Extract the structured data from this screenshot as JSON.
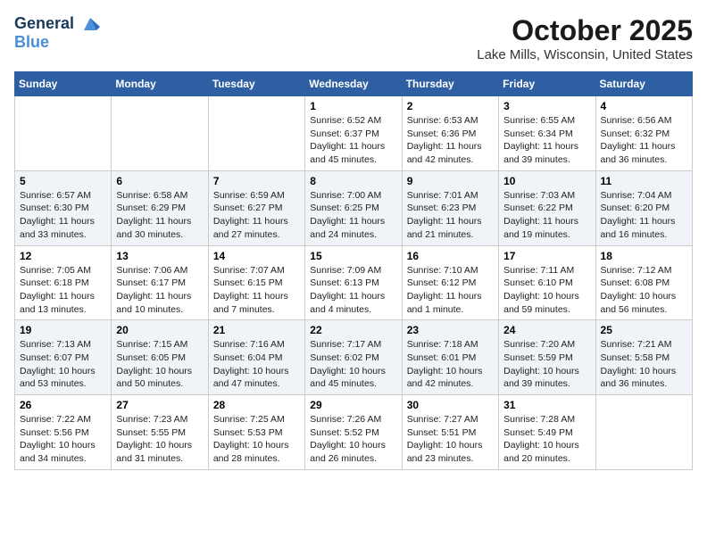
{
  "header": {
    "logo_line1": "General",
    "logo_line2": "Blue",
    "month": "October 2025",
    "location": "Lake Mills, Wisconsin, United States"
  },
  "weekdays": [
    "Sunday",
    "Monday",
    "Tuesday",
    "Wednesday",
    "Thursday",
    "Friday",
    "Saturday"
  ],
  "weeks": [
    [
      {
        "day": "",
        "sunrise": "",
        "sunset": "",
        "daylight": ""
      },
      {
        "day": "",
        "sunrise": "",
        "sunset": "",
        "daylight": ""
      },
      {
        "day": "",
        "sunrise": "",
        "sunset": "",
        "daylight": ""
      },
      {
        "day": "1",
        "sunrise": "Sunrise: 6:52 AM",
        "sunset": "Sunset: 6:37 PM",
        "daylight": "Daylight: 11 hours and 45 minutes."
      },
      {
        "day": "2",
        "sunrise": "Sunrise: 6:53 AM",
        "sunset": "Sunset: 6:36 PM",
        "daylight": "Daylight: 11 hours and 42 minutes."
      },
      {
        "day": "3",
        "sunrise": "Sunrise: 6:55 AM",
        "sunset": "Sunset: 6:34 PM",
        "daylight": "Daylight: 11 hours and 39 minutes."
      },
      {
        "day": "4",
        "sunrise": "Sunrise: 6:56 AM",
        "sunset": "Sunset: 6:32 PM",
        "daylight": "Daylight: 11 hours and 36 minutes."
      }
    ],
    [
      {
        "day": "5",
        "sunrise": "Sunrise: 6:57 AM",
        "sunset": "Sunset: 6:30 PM",
        "daylight": "Daylight: 11 hours and 33 minutes."
      },
      {
        "day": "6",
        "sunrise": "Sunrise: 6:58 AM",
        "sunset": "Sunset: 6:29 PM",
        "daylight": "Daylight: 11 hours and 30 minutes."
      },
      {
        "day": "7",
        "sunrise": "Sunrise: 6:59 AM",
        "sunset": "Sunset: 6:27 PM",
        "daylight": "Daylight: 11 hours and 27 minutes."
      },
      {
        "day": "8",
        "sunrise": "Sunrise: 7:00 AM",
        "sunset": "Sunset: 6:25 PM",
        "daylight": "Daylight: 11 hours and 24 minutes."
      },
      {
        "day": "9",
        "sunrise": "Sunrise: 7:01 AM",
        "sunset": "Sunset: 6:23 PM",
        "daylight": "Daylight: 11 hours and 21 minutes."
      },
      {
        "day": "10",
        "sunrise": "Sunrise: 7:03 AM",
        "sunset": "Sunset: 6:22 PM",
        "daylight": "Daylight: 11 hours and 19 minutes."
      },
      {
        "day": "11",
        "sunrise": "Sunrise: 7:04 AM",
        "sunset": "Sunset: 6:20 PM",
        "daylight": "Daylight: 11 hours and 16 minutes."
      }
    ],
    [
      {
        "day": "12",
        "sunrise": "Sunrise: 7:05 AM",
        "sunset": "Sunset: 6:18 PM",
        "daylight": "Daylight: 11 hours and 13 minutes."
      },
      {
        "day": "13",
        "sunrise": "Sunrise: 7:06 AM",
        "sunset": "Sunset: 6:17 PM",
        "daylight": "Daylight: 11 hours and 10 minutes."
      },
      {
        "day": "14",
        "sunrise": "Sunrise: 7:07 AM",
        "sunset": "Sunset: 6:15 PM",
        "daylight": "Daylight: 11 hours and 7 minutes."
      },
      {
        "day": "15",
        "sunrise": "Sunrise: 7:09 AM",
        "sunset": "Sunset: 6:13 PM",
        "daylight": "Daylight: 11 hours and 4 minutes."
      },
      {
        "day": "16",
        "sunrise": "Sunrise: 7:10 AM",
        "sunset": "Sunset: 6:12 PM",
        "daylight": "Daylight: 11 hours and 1 minute."
      },
      {
        "day": "17",
        "sunrise": "Sunrise: 7:11 AM",
        "sunset": "Sunset: 6:10 PM",
        "daylight": "Daylight: 10 hours and 59 minutes."
      },
      {
        "day": "18",
        "sunrise": "Sunrise: 7:12 AM",
        "sunset": "Sunset: 6:08 PM",
        "daylight": "Daylight: 10 hours and 56 minutes."
      }
    ],
    [
      {
        "day": "19",
        "sunrise": "Sunrise: 7:13 AM",
        "sunset": "Sunset: 6:07 PM",
        "daylight": "Daylight: 10 hours and 53 minutes."
      },
      {
        "day": "20",
        "sunrise": "Sunrise: 7:15 AM",
        "sunset": "Sunset: 6:05 PM",
        "daylight": "Daylight: 10 hours and 50 minutes."
      },
      {
        "day": "21",
        "sunrise": "Sunrise: 7:16 AM",
        "sunset": "Sunset: 6:04 PM",
        "daylight": "Daylight: 10 hours and 47 minutes."
      },
      {
        "day": "22",
        "sunrise": "Sunrise: 7:17 AM",
        "sunset": "Sunset: 6:02 PM",
        "daylight": "Daylight: 10 hours and 45 minutes."
      },
      {
        "day": "23",
        "sunrise": "Sunrise: 7:18 AM",
        "sunset": "Sunset: 6:01 PM",
        "daylight": "Daylight: 10 hours and 42 minutes."
      },
      {
        "day": "24",
        "sunrise": "Sunrise: 7:20 AM",
        "sunset": "Sunset: 5:59 PM",
        "daylight": "Daylight: 10 hours and 39 minutes."
      },
      {
        "day": "25",
        "sunrise": "Sunrise: 7:21 AM",
        "sunset": "Sunset: 5:58 PM",
        "daylight": "Daylight: 10 hours and 36 minutes."
      }
    ],
    [
      {
        "day": "26",
        "sunrise": "Sunrise: 7:22 AM",
        "sunset": "Sunset: 5:56 PM",
        "daylight": "Daylight: 10 hours and 34 minutes."
      },
      {
        "day": "27",
        "sunrise": "Sunrise: 7:23 AM",
        "sunset": "Sunset: 5:55 PM",
        "daylight": "Daylight: 10 hours and 31 minutes."
      },
      {
        "day": "28",
        "sunrise": "Sunrise: 7:25 AM",
        "sunset": "Sunset: 5:53 PM",
        "daylight": "Daylight: 10 hours and 28 minutes."
      },
      {
        "day": "29",
        "sunrise": "Sunrise: 7:26 AM",
        "sunset": "Sunset: 5:52 PM",
        "daylight": "Daylight: 10 hours and 26 minutes."
      },
      {
        "day": "30",
        "sunrise": "Sunrise: 7:27 AM",
        "sunset": "Sunset: 5:51 PM",
        "daylight": "Daylight: 10 hours and 23 minutes."
      },
      {
        "day": "31",
        "sunrise": "Sunrise: 7:28 AM",
        "sunset": "Sunset: 5:49 PM",
        "daylight": "Daylight: 10 hours and 20 minutes."
      },
      {
        "day": "",
        "sunrise": "",
        "sunset": "",
        "daylight": ""
      }
    ]
  ]
}
